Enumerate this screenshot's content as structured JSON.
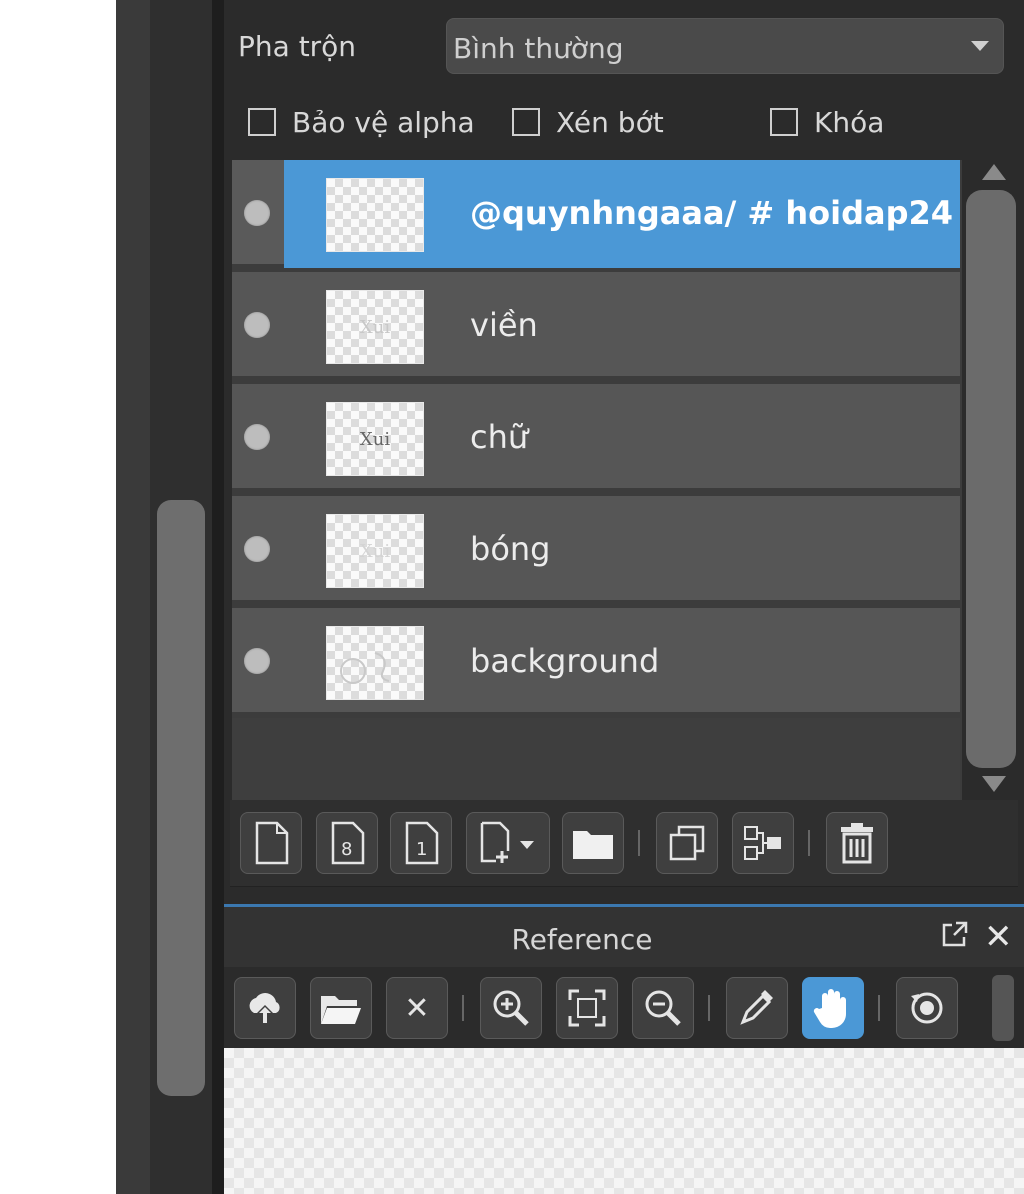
{
  "blend": {
    "label": "Pha trộn",
    "value": "Bình thường"
  },
  "options": {
    "protect_alpha": "Bảo vệ alpha",
    "clipping": "Xén bớt",
    "lock": "Khóa"
  },
  "layers": [
    {
      "name": "@quynhngaaa/ # hoidap24",
      "selected": true,
      "thumb_text": ""
    },
    {
      "name": "viền",
      "selected": false,
      "thumb_text": "Xui"
    },
    {
      "name": "chữ",
      "selected": false,
      "thumb_text": "Xui"
    },
    {
      "name": "bóng",
      "selected": false,
      "thumb_text": "Xui"
    },
    {
      "name": "background",
      "selected": false,
      "thumb_text": ""
    }
  ],
  "layer_toolbar": [
    "new-layer-icon",
    "new-8bit-layer-icon",
    "new-1bit-layer-icon",
    "add-layer-dropdown-icon",
    "new-folder-icon",
    "duplicate-layer-icon",
    "merge-down-icon",
    "delete-layer-icon"
  ],
  "reference": {
    "title": "Reference",
    "tools": [
      "cloud-upload-icon",
      "open-folder-icon",
      "close-icon",
      "zoom-in-icon",
      "fit-screen-icon",
      "zoom-out-icon",
      "eyedropper-icon",
      "hand-icon",
      "rotate-icon"
    ],
    "active_tool": "hand-icon"
  },
  "colors": {
    "accent": "#4b98d6",
    "panel_bg": "#2b2b2b",
    "layer_row": "#565656"
  }
}
